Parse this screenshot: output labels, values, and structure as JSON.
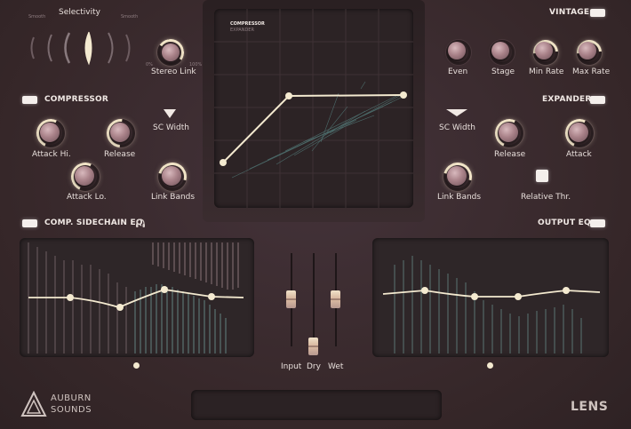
{
  "top": {
    "selectivity": {
      "title": "Selectivity",
      "left_label": "Smooth",
      "right_label": "Smooth"
    },
    "stereo_link": {
      "label": "Stereo Link",
      "min": "0%",
      "max": "100%"
    },
    "vintage": {
      "title": "VINTAGE",
      "knobs": [
        "Even",
        "Stage",
        "Min Rate",
        "Max Rate"
      ]
    }
  },
  "display": {
    "line1": "COMPRESSOR",
    "line2": "EXPANDER"
  },
  "compressor": {
    "title": "COMPRESSOR",
    "knobs": [
      "Attack Hi.",
      "Release",
      "Attack Lo.",
      "Link Bands"
    ],
    "sc_width": "SC Width"
  },
  "expander": {
    "title": "EXPANDER",
    "sc_width": "SC Width",
    "knobs": [
      "Release",
      "Attack",
      "Link Bands"
    ],
    "relative_thr": "Relative Thr."
  },
  "sidechain_eq": {
    "title": "COMP. SIDECHAIN EQ"
  },
  "output_eq": {
    "title": "OUTPUT EQ"
  },
  "faders": {
    "labels": [
      "Input",
      "Dry",
      "Wet"
    ]
  },
  "brand": {
    "line1": "AUBURN",
    "line2": "SOUNDS",
    "product": "LENS"
  },
  "colors": {
    "accent": "#f3e6c9",
    "background": "#3a2b2e"
  }
}
